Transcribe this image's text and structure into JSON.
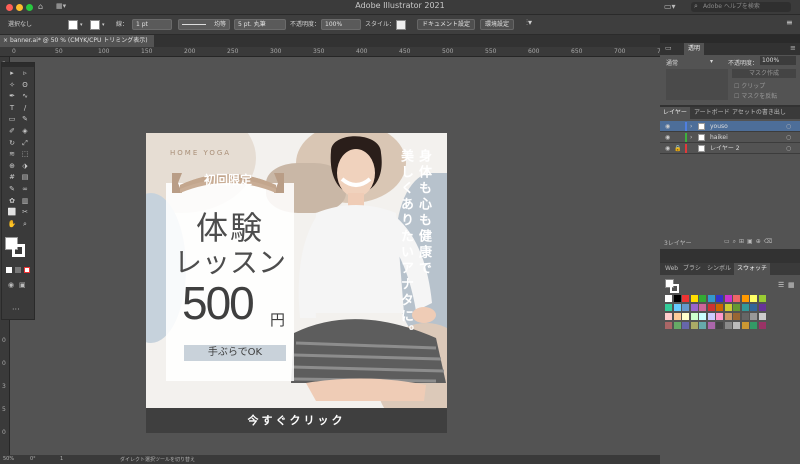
{
  "app": {
    "title": "Adobe Illustrator 2021",
    "search_placeholder": "Adobe ヘルプを検索"
  },
  "control_bar": {
    "selection": "選択なし",
    "stroke_label": "線：",
    "stroke_value": "1 pt",
    "line_style": "均等",
    "brush": "5 pt. 丸筆",
    "opacity_label": "不透明度：",
    "opacity_value": "100%",
    "style_label": "スタイル：",
    "doc_setup": "ドキュメント設定",
    "prefs": "環境設定"
  },
  "document_tab": {
    "label": "banner.ai* @ 50 % (CMYK/CPU トリミング表示)"
  },
  "rulers": {
    "h": [
      "0",
      "50",
      "100",
      "150",
      "200",
      "250",
      "300",
      "350",
      "400",
      "450",
      "500",
      "550",
      "600",
      "650",
      "700",
      "750",
      "800",
      "850",
      "900",
      "950"
    ],
    "v": [
      "5",
      "0",
      "1",
      "5",
      "0",
      "2",
      "0",
      "0",
      "2",
      "5",
      "0",
      "3",
      "0",
      "0",
      "3",
      "5",
      "0"
    ]
  },
  "status_bar": {
    "zoom": "50%",
    "angle": "0°",
    "page": "1",
    "tool_hint": "ダイレクト選択ツールを切り替え"
  },
  "transparency_panel": {
    "tab": "透明",
    "blend_mode": "通常",
    "opacity_label": "不透明度：",
    "opacity_value": "100%",
    "make_mask": "マスク作成",
    "clip": "クリップ",
    "invert_mask": "マスクを反転"
  },
  "layers_panel": {
    "tabs": [
      "レイヤー",
      "アートボード",
      "アセットの書き出し"
    ],
    "layers": [
      {
        "name": "youso",
        "color": "#4f7fe0"
      },
      {
        "name": "haikei",
        "color": "#3db03d"
      },
      {
        "name": "レイヤー 2",
        "color": "#e03a3a"
      }
    ],
    "count": "3レイヤー"
  },
  "swatch_panel": {
    "tabs": [
      "Web",
      "ブラシ",
      "シンボル",
      "スウォッチ"
    ]
  },
  "artwork": {
    "label_en": "HOME YOGA",
    "ribbon": "初回限定",
    "heading1": "体験",
    "heading2": "レッスン",
    "price": "500",
    "yen": "円",
    "note": "手ぶらでOK",
    "vertical1": "身体も心も健康で",
    "vertical2": "美しくありたいアナタに。",
    "cta": "今すぐクリック"
  }
}
